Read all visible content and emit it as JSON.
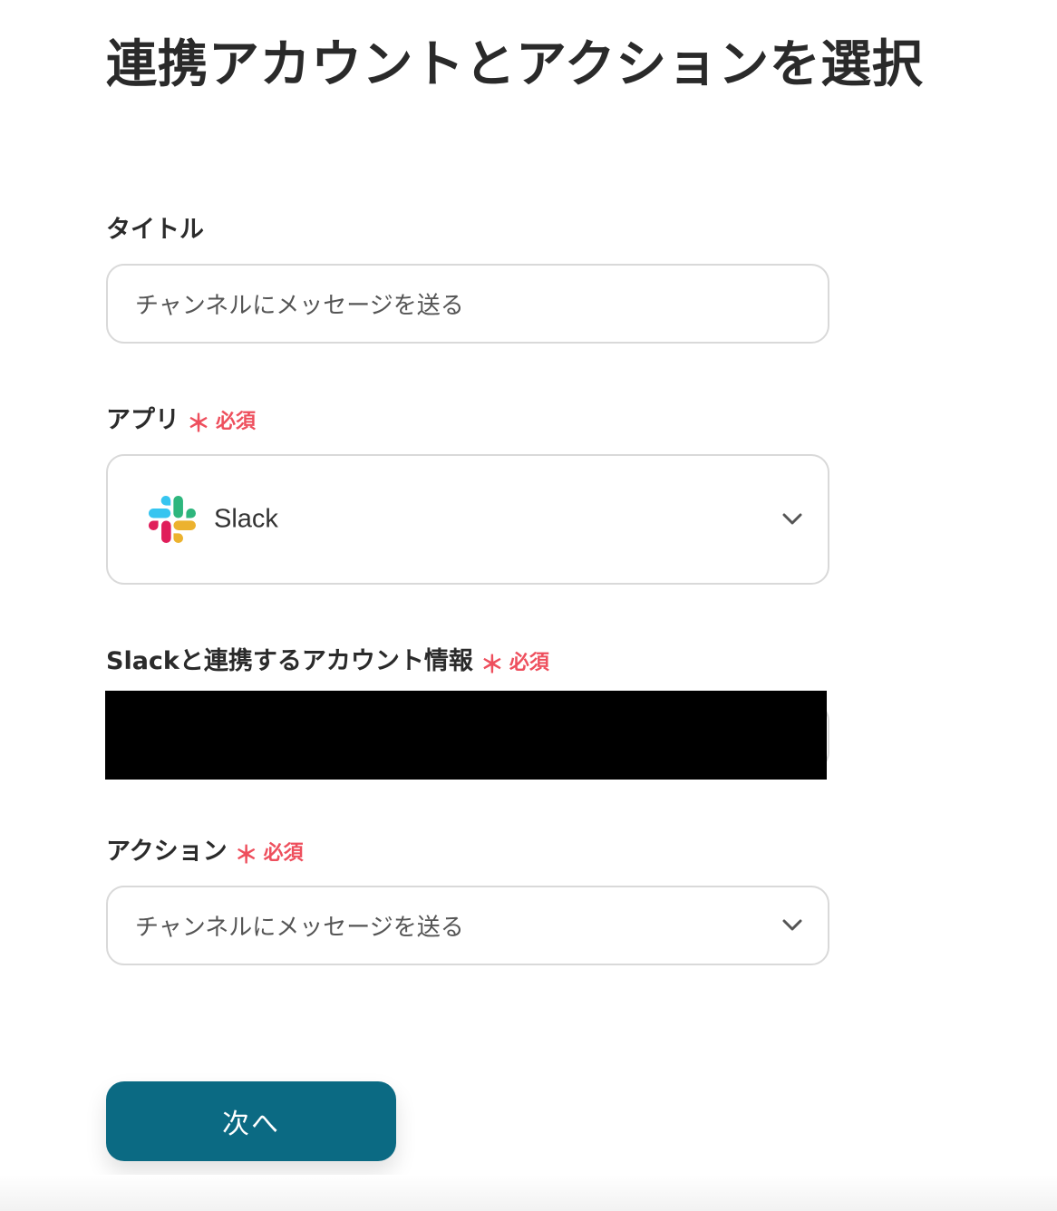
{
  "page": {
    "title": "連携アカウントとアクションを選択"
  },
  "fields": {
    "title": {
      "label": "タイトル",
      "value": "チャンネルにメッセージを送る"
    },
    "app": {
      "label": "アプリ",
      "required_mark": "＊",
      "required_text": "必須",
      "value": "Slack",
      "icon": "slack-logo-icon"
    },
    "account": {
      "label": "Slackと連携するアカウント情報",
      "required_mark": "＊",
      "required_text": "必須"
    },
    "action": {
      "label": "アクション",
      "required_mark": "＊",
      "required_text": "必須",
      "value": "チャンネルにメッセージを送る"
    }
  },
  "buttons": {
    "next_label": "次へ"
  },
  "colors": {
    "required": "#ee4f5d",
    "primary_button": "#0b6a83",
    "border": "#d9d9d9"
  }
}
